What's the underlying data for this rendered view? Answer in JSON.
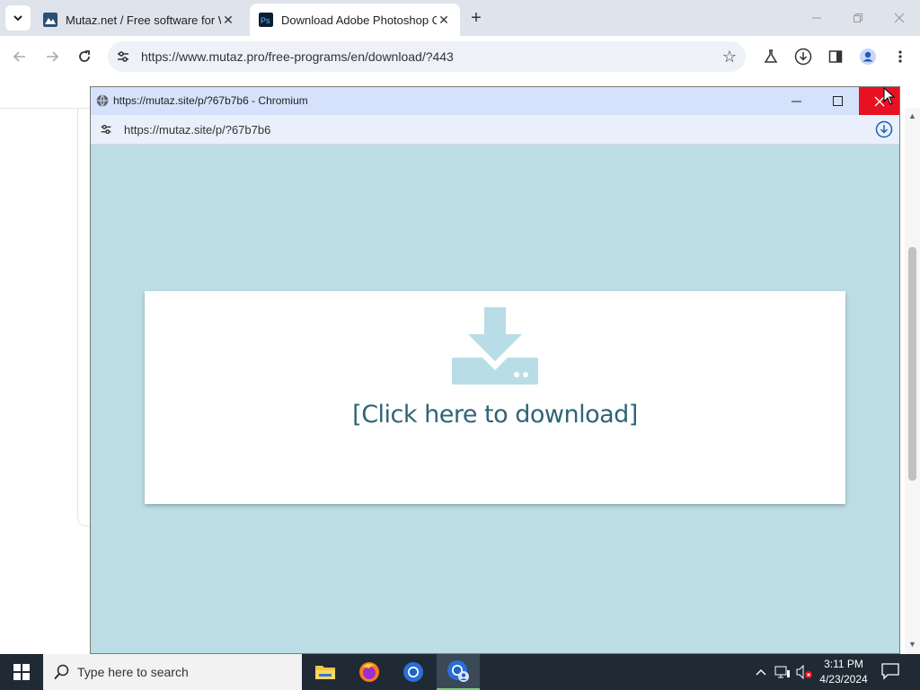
{
  "browser": {
    "tabs": [
      {
        "title": "Mutaz.net / Free software for W",
        "active": false
      },
      {
        "title": "Download Adobe Photoshop C",
        "active": true
      }
    ],
    "address": "https://www.mutaz.pro/free-programs/en/download/?443"
  },
  "popup": {
    "window_title": "https://mutaz.site/p/?67b7b6 - Chromium",
    "address": "https://mutaz.site/p/?67b7b6",
    "download_link": "[Click here to download]"
  },
  "taskbar": {
    "search_placeholder": "Type here to search",
    "time": "3:11 PM",
    "date": "4/23/2024"
  },
  "colors": {
    "popup_bg": "#bcdde4",
    "link": "#2f6477",
    "icon": "#b9dde6",
    "close_red": "#e81123"
  }
}
